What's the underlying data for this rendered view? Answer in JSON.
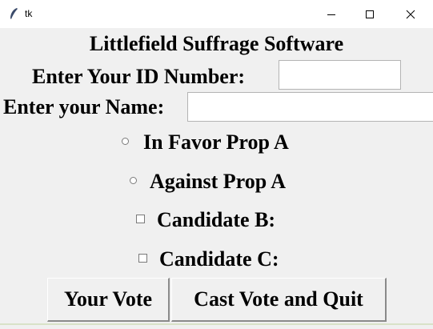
{
  "window": {
    "title": "tk",
    "minimize_icon": "minimize-icon",
    "maximize_icon": "maximize-icon",
    "close_icon": "close-icon"
  },
  "app": {
    "heading": "Littlefield Suffrage Software",
    "id_label": "Enter Your ID Number:",
    "id_value": "",
    "name_label": "Enter your Name:",
    "name_value": ""
  },
  "options": {
    "radio_favor": "In Favor Prop A",
    "radio_against": "Against Prop A",
    "check_b": "Candidate B:",
    "check_c": "Candidate C:"
  },
  "buttons": {
    "your_vote": "Your Vote",
    "cast_quit": "Cast Vote and Quit"
  }
}
